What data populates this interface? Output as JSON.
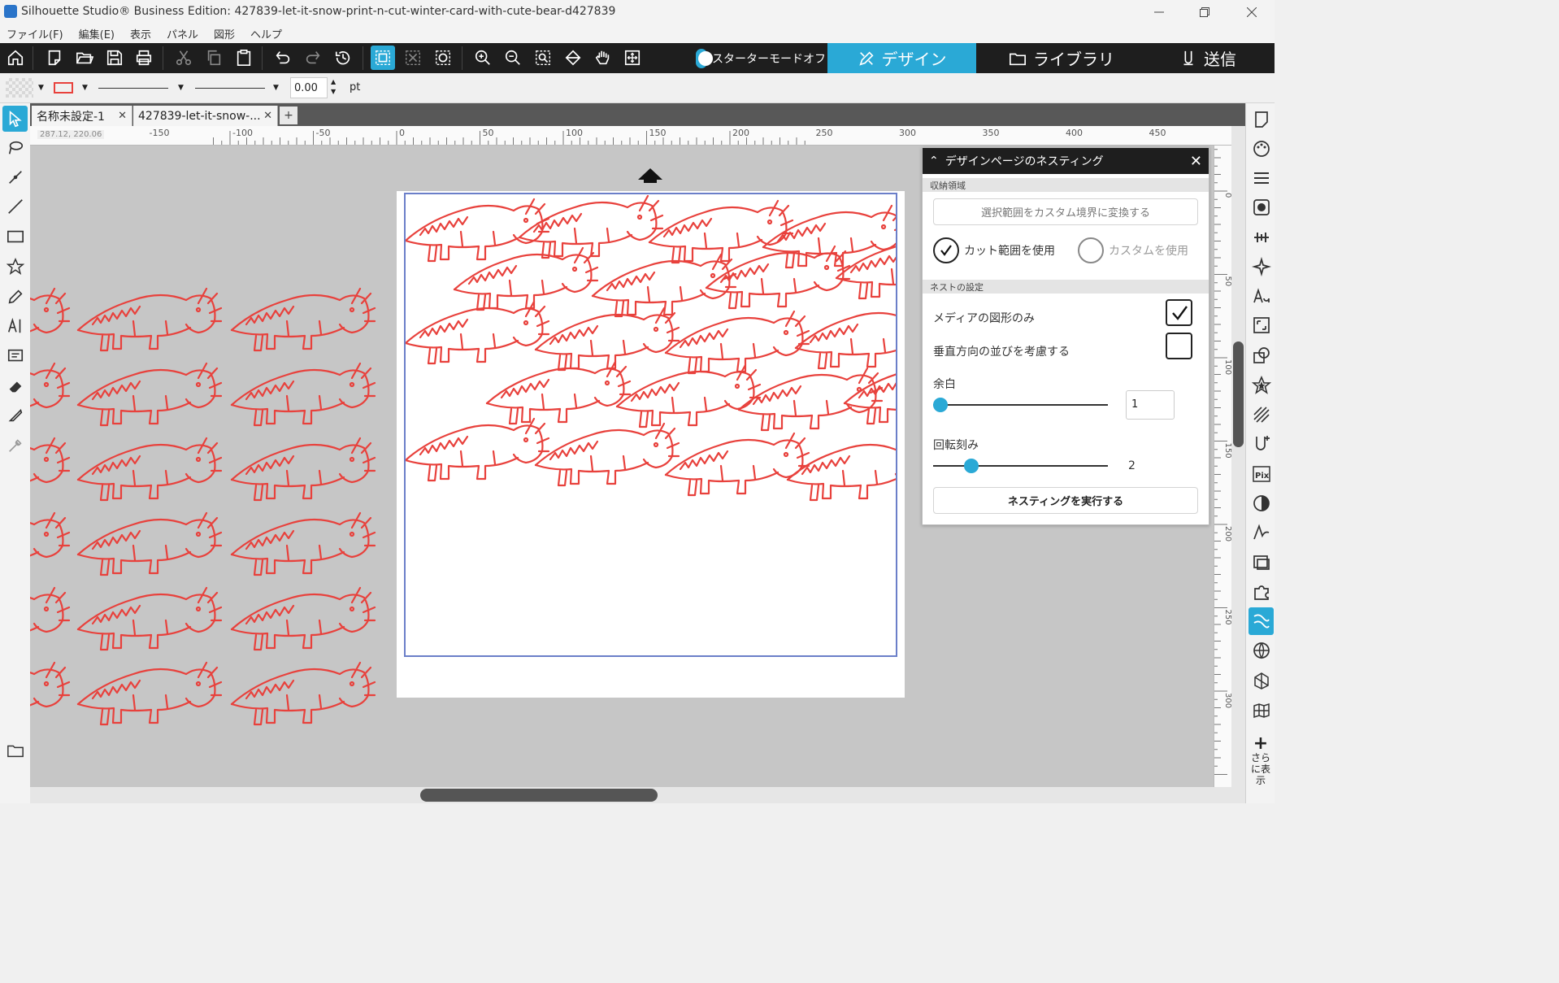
{
  "window": {
    "title": "Silhouette Studio® Business Edition: 427839-let-it-snow-print-n-cut-winter-card-with-cute-bear-d427839",
    "controls": [
      "minimize",
      "restore",
      "close"
    ]
  },
  "menu": [
    "ファイル(F)",
    "編集(E)",
    "表示",
    "パネル",
    "図形",
    "ヘルプ"
  ],
  "toolbar": {
    "starter_mode_label": "スターターモードオフ",
    "nav": {
      "design": "デザイン",
      "library": "ライブラリ",
      "send": "送信"
    }
  },
  "linebar": {
    "line_width_value": "0.00",
    "unit": "pt"
  },
  "tabs": [
    {
      "label": "名称未設定-1"
    },
    {
      "label": "427839-let-it-snow-..."
    }
  ],
  "ruler": {
    "cursor_pos": "287.12, 220.06",
    "h_ticks": [
      "-150",
      "-100",
      "-50",
      "0",
      "50",
      "100",
      "150",
      "200",
      "250",
      "300",
      "350",
      "400",
      "450"
    ],
    "v_ticks": [
      "0",
      "50",
      "100",
      "150",
      "200",
      "250",
      "300"
    ]
  },
  "nesting": {
    "title": "デザインページのネスティング",
    "section_storage": "収納領域",
    "convert_button": "選択範囲をカスタム境界に変換する",
    "use_cut_area": "カット範囲を使用",
    "use_custom": "カスタムを使用",
    "section_nest": "ネストの設定",
    "media_shapes_only": "メディアの図形のみ",
    "media_shapes_only_checked": true,
    "consider_vertical": "垂直方向の並びを考慮する",
    "consider_vertical_checked": false,
    "margin_label": "余白",
    "margin_value": "1",
    "rotation_label": "回転刻み",
    "rotation_value": "2",
    "run_button": "ネスティングを実行する"
  },
  "rightbar": {
    "more_label": "さらに表示"
  },
  "colors": {
    "accent": "#2aa9d6",
    "cut_line": "#e8413c",
    "toolbar_bg": "#1e1e1e",
    "canvas_bg": "#c6c6c6"
  }
}
